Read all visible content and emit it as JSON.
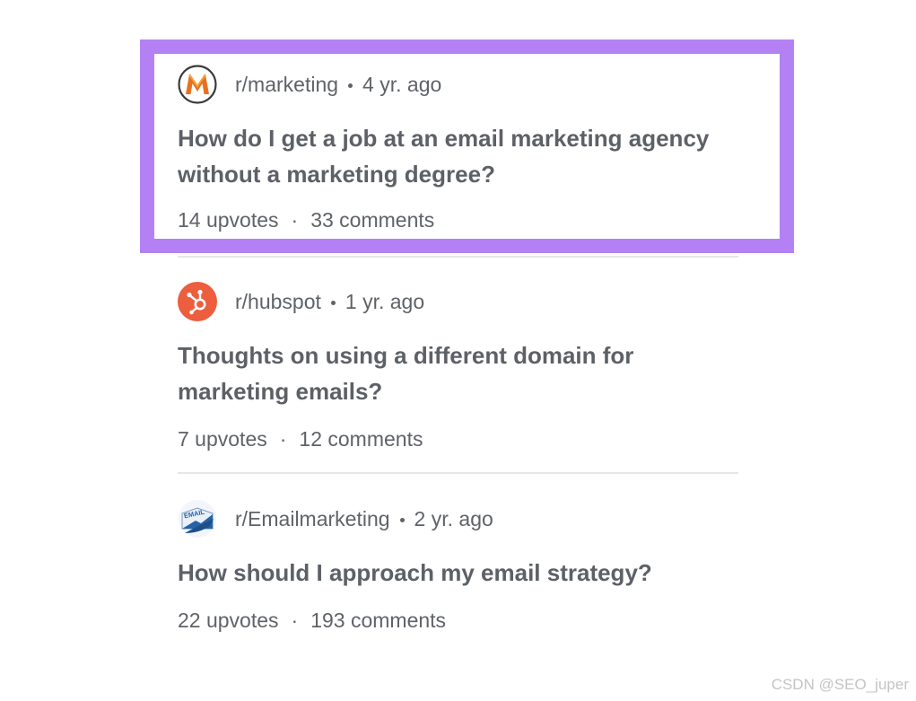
{
  "posts": [
    {
      "subreddit": "r/marketing",
      "age": "4 yr. ago",
      "title": "How do I get a job at an email marketing agency without a marketing degree?",
      "upvotes": "14 upvotes",
      "separator": "·",
      "comments": "33 comments",
      "icon": "marketing-m-logo"
    },
    {
      "subreddit": "r/hubspot",
      "age": "1 yr. ago",
      "title": "Thoughts on using a different domain for marketing emails?",
      "upvotes": "7 upvotes",
      "separator": "·",
      "comments": "12 comments",
      "icon": "hubspot-sprocket-logo"
    },
    {
      "subreddit": "r/Emailmarketing",
      "age": "2 yr. ago",
      "title": "How should I approach my email strategy?",
      "upvotes": "22 upvotes",
      "separator": "·",
      "comments": "193 comments",
      "icon": "email-envelope-logo",
      "icon_text": "EMAIL"
    }
  ],
  "highlight": {
    "color": "#b481f4",
    "target": "post-1"
  },
  "colors": {
    "text": "#5d6167",
    "marketing_logo": "#e8711f",
    "hubspot_logo": "#ec5e3d",
    "email_logo": "#2563a8"
  },
  "watermark": "CSDN @SEO_juper"
}
